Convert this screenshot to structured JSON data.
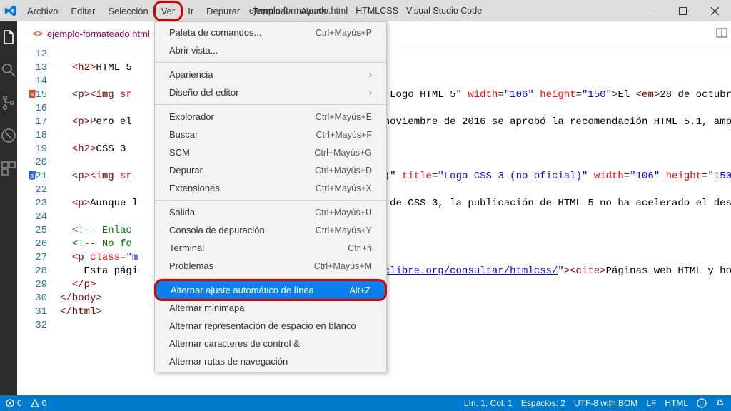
{
  "title": "ejemplo-formateado.html - HTMLCSS - Visual Studio Code",
  "menu": [
    "Archivo",
    "Editar",
    "Selección",
    "Ver",
    "Ir",
    "Depurar",
    "Terminal",
    "Ayuda"
  ],
  "tab": {
    "label": "ejemplo-formateado.html"
  },
  "dropdown": [
    {
      "type": "item",
      "label": "Paleta de comandos...",
      "shortcut": "Ctrl+Mayús+P"
    },
    {
      "type": "item",
      "label": "Abrir vista..."
    },
    {
      "type": "sep"
    },
    {
      "type": "item",
      "label": "Apariencia",
      "sub": true
    },
    {
      "type": "item",
      "label": "Diseño del editor",
      "sub": true
    },
    {
      "type": "sep"
    },
    {
      "type": "item",
      "label": "Explorador",
      "shortcut": "Ctrl+Mayús+E"
    },
    {
      "type": "item",
      "label": "Buscar",
      "shortcut": "Ctrl+Mayús+F"
    },
    {
      "type": "item",
      "label": "SCM",
      "shortcut": "Ctrl+Mayús+G"
    },
    {
      "type": "item",
      "label": "Depurar",
      "shortcut": "Ctrl+Mayús+D"
    },
    {
      "type": "item",
      "label": "Extensiones",
      "shortcut": "Ctrl+Mayús+X"
    },
    {
      "type": "sep"
    },
    {
      "type": "item",
      "label": "Salida",
      "shortcut": "Ctrl+Mayús+U"
    },
    {
      "type": "item",
      "label": "Consola de depuración",
      "shortcut": "Ctrl+Mayús+Y"
    },
    {
      "type": "item",
      "label": "Terminal",
      "shortcut": "Ctrl+ñ"
    },
    {
      "type": "item",
      "label": "Problemas",
      "shortcut": "Ctrl+Mayús+M"
    },
    {
      "type": "sep"
    },
    {
      "type": "item",
      "label": "Alternar ajuste automático de línea",
      "shortcut": "Alt+Z",
      "selected": true
    },
    {
      "type": "item",
      "label": "Alternar minimapa"
    },
    {
      "type": "item",
      "label": "Alternar representación de espacio en blanco"
    },
    {
      "type": "item",
      "label": "Alternar caracteres de control &"
    },
    {
      "type": "item",
      "label": "Alternar rutas de navegación"
    }
  ],
  "lines": [
    {
      "n": 12,
      "html": ""
    },
    {
      "n": 13,
      "html": "  <span class='tok-tag'>&lt;h2&gt;</span><span class='tok-txt'>HTML 5</span>"
    },
    {
      "n": 14,
      "html": ""
    },
    {
      "n": 15,
      "icon": "html5",
      "html": "  <span class='tok-tag'>&lt;p&gt;&lt;img</span> <span class='tok-attr'>sr</span>                                           <span class='tok-txt'>Logo HTML 5\"</span> <span class='tok-attr'>width</span>=<span class='tok-str'>\"106\"</span> <span class='tok-attr'>height</span>=<span class='tok-str'>\"150\"</span><span class='tok-tag'>&gt;</span><span class='tok-txt'>El </span><span class='tok-tag'>&lt;em&gt;</span><span class='tok-txt'>28 de octubre de</span>"
    },
    {
      "n": 16,
      "html": ""
    },
    {
      "n": 17,
      "html": "  <span class='tok-tag'>&lt;p&gt;</span><span class='tok-txt'>Pero el                                       de noviembre de 2016 se aprobó la recomendación HTML 5.1, ampl</span>"
    },
    {
      "n": 18,
      "html": ""
    },
    {
      "n": 19,
      "html": "  <span class='tok-tag'>&lt;h2&gt;</span><span class='tok-txt'>CSS 3</span>"
    },
    {
      "n": 20,
      "html": ""
    },
    {
      "n": 21,
      "icon": "css3",
      "html": "  <span class='tok-tag'>&lt;p&gt;&lt;img</span> <span class='tok-attr'>sr</span>                                         <span class='tok-txt'>l)\"</span> <span class='tok-attr'>title</span>=<span class='tok-str'>\"Logo CSS 3 (no oficial)\"</span> <span class='tok-attr'>width</span>=<span class='tok-str'>\"106\"</span> <span class='tok-attr'>height</span>=<span class='tok-str'>\"150\"</span><span class='tok-tag'>&gt;</span><span class='tok-txt'>D</span>"
    },
    {
      "n": 22,
      "html": ""
    },
    {
      "n": 23,
      "html": "  <span class='tok-tag'>&lt;p&gt;</span><span class='tok-txt'>Aunque l                                       as de CSS 3, la publicación de HTML 5 no ha acelerado el desar</span>"
    },
    {
      "n": 24,
      "html": ""
    },
    {
      "n": 25,
      "html": "  <span class='tok-cmt'>&lt;!-- Enlac</span>"
    },
    {
      "n": 26,
      "html": "  <span class='tok-cmt'>&lt;!-- No fo</span>"
    },
    {
      "n": 27,
      "html": "  <span class='tok-tag'>&lt;p</span> <span class='tok-attr'>class</span>=<span class='tok-str'>\"m</span>"
    },
    {
      "n": 28,
      "html": "    <span class='tok-txt'>Esta pági</span>                                      <span class='tok-lnk'>w.mclibre.org/consultar/htmlcss/</span><span class='tok-str'>\"</span><span class='tok-tag'>&gt;&lt;cite&gt;</span><span class='tok-txt'>Páginas web HTML y hoj</span>"
    },
    {
      "n": 29,
      "html": "  <span class='tok-tag'>&lt;/p&gt;</span>"
    },
    {
      "n": 30,
      "html": "<span class='tok-tag'>&lt;/body&gt;</span>"
    },
    {
      "n": 31,
      "html": "<span class='tok-tag'>&lt;/html&gt;</span>"
    },
    {
      "n": 32,
      "html": ""
    }
  ],
  "status": {
    "errors": "0",
    "warnings": "0",
    "lncol": "Lín. 1, Col. 1",
    "spaces": "Espacios: 2",
    "encoding": "UTF-8 with BOM",
    "eol": "LF",
    "lang": "HTML"
  }
}
